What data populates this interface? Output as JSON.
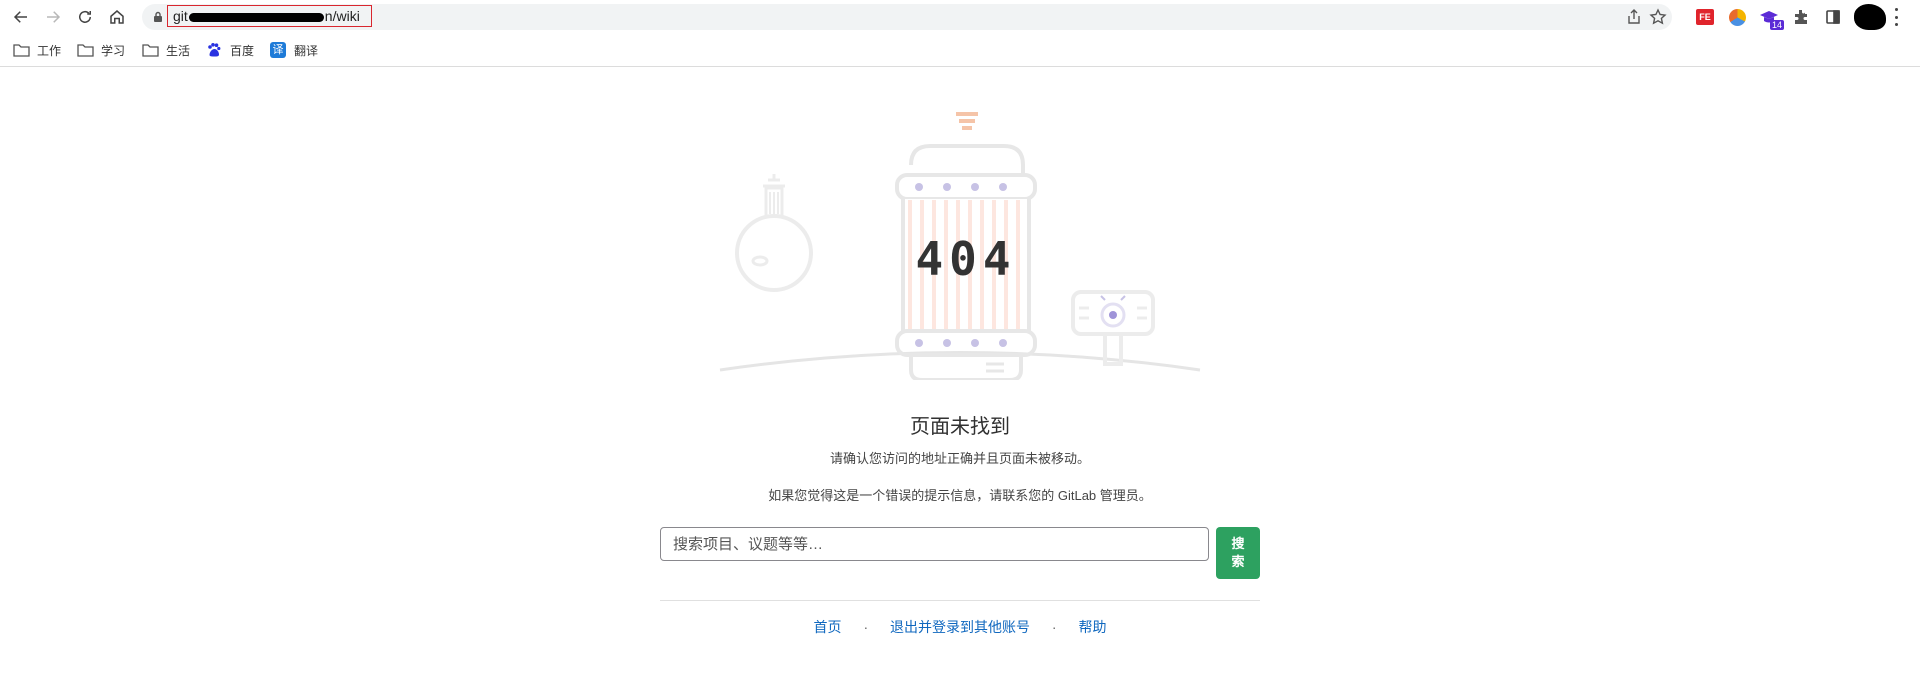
{
  "browser": {
    "url_prefix": "git",
    "url_suffix": "n/wiki",
    "extensions": [
      "translate-extension-icon",
      "color-ball-extension-icon",
      "graduation-extension-icon",
      "puzzle-extensions-icon",
      "side-panel-icon"
    ],
    "extension_badge": "14"
  },
  "bookmarks": [
    {
      "label": "工作",
      "icon": "folder-icon"
    },
    {
      "label": "学习",
      "icon": "folder-icon"
    },
    {
      "label": "生活",
      "icon": "folder-icon"
    },
    {
      "label": "百度",
      "icon": "baidu-paw-icon"
    },
    {
      "label": "翻译",
      "icon": "translate-icon"
    }
  ],
  "error": {
    "code": "404",
    "title": "页面未找到",
    "line1": "请确认您访问的地址正确并且页面未被移动。",
    "line2": "如果您觉得这是一个错误的提示信息，请联系您的 GitLab 管理员。"
  },
  "search": {
    "placeholder": "搜索项目、议题等等…",
    "button_label": "搜索"
  },
  "footer": {
    "home": "首页",
    "separator": "·",
    "switch_account": "退出并登录到其他账号",
    "help": "帮助"
  },
  "colors": {
    "accent_green": "#2da160",
    "link_blue": "#1068bf",
    "highlight_red": "#d9262e"
  }
}
